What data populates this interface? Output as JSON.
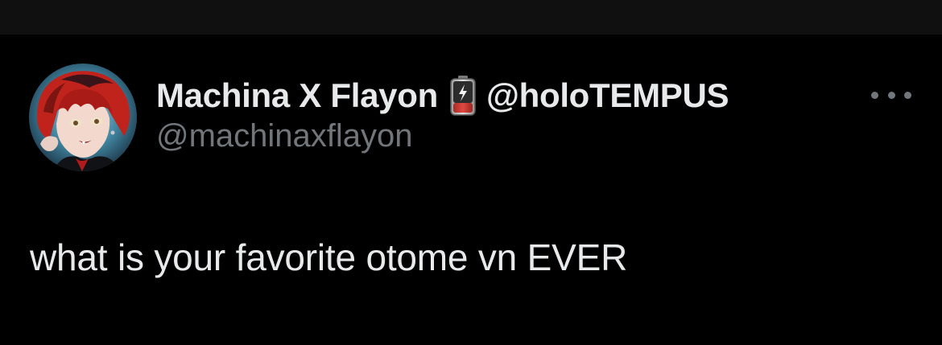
{
  "tweet": {
    "author": {
      "display_name": "Machina X Flayon",
      "badge_icon": "battery-low-icon",
      "affiliation": "@holoTEMPUS",
      "handle": "@machinaxflayon"
    },
    "text": "what is your favorite otome vn EVER",
    "more_icon": "more-horizontal-icon"
  },
  "colors": {
    "background": "#000000",
    "top_bar": "#101010",
    "primary_text": "#e7e9ea",
    "secondary_text": "#71767b",
    "battery_red": "#d8403a"
  }
}
